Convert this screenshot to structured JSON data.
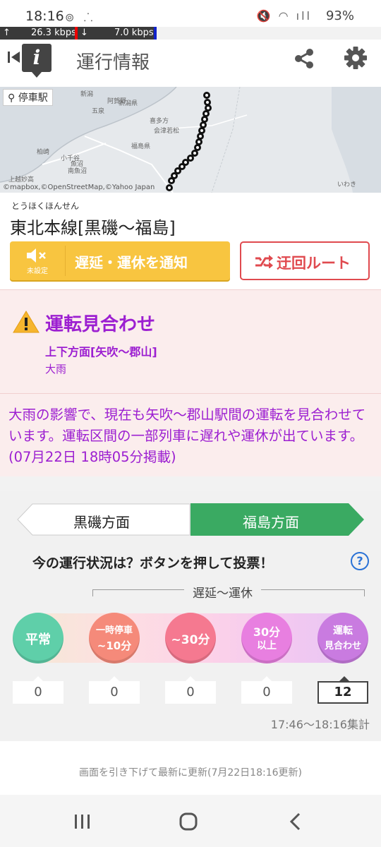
{
  "status_bar": {
    "time": "18:16",
    "battery": "93%",
    "up_speed": "26.3 kbps",
    "down_speed": "7.0 kbps"
  },
  "app_bar": {
    "title": "運行情報",
    "icons": [
      "back-icon",
      "info-logo-icon",
      "share-icon",
      "gear-icon"
    ]
  },
  "map": {
    "stop_label": "停車駅",
    "credit": "©mapbox,©OpenStreetMap,©Yahoo Japan",
    "places": [
      "新潟",
      "新潟県",
      "五泉",
      "阿賀野",
      "会津若松",
      "喜多方",
      "福島県",
      "柏崎",
      "魚沼",
      "小千谷",
      "南魚沼",
      "上越妙高",
      "いわき"
    ]
  },
  "line": {
    "kana": "とうほくほんせん",
    "name": "東北本線[黒磯～福島]"
  },
  "notify_button": {
    "label": "遅延・運休を通知",
    "sub_label": "未設定"
  },
  "detour_button": {
    "label": "迂回ルート"
  },
  "alert": {
    "status": "運転見合わせ",
    "section": "上下方面[矢吹～郡山]",
    "cause": "大雨",
    "message": "大雨の影響で、現在も矢吹～郡山駅間の運転を見合わせています。運転区間の一部列車に遅れや運休が出ています。(07月22日 18時05分掲載)"
  },
  "vote": {
    "tabs": [
      {
        "label": "黒磯方面",
        "active": false
      },
      {
        "label": "福島方面",
        "active": true
      }
    ],
    "question": "今の運行状況は？ボタンを押して投票！",
    "range_label": "遅延～運休",
    "options": [
      {
        "line1": "平常",
        "line2": "",
        "count": "0",
        "color": "#5fcfa9"
      },
      {
        "line1": "一時停車",
        "line2": "~10分",
        "count": "0",
        "color": "#f58a7a"
      },
      {
        "line1": "~30分",
        "line2": "",
        "count": "0",
        "color": "#f57990"
      },
      {
        "line1": "30分",
        "line2": "以上",
        "count": "0",
        "color": "#e87fe0"
      },
      {
        "line1": "運転",
        "line2": "見合わせ",
        "count": "12",
        "color": "#c97be0"
      }
    ],
    "period": "17:46～18:16集計"
  },
  "footer": {
    "update_text": "画面を引き下げて最新に更新(7月22日18:16更新)"
  },
  "colors": {
    "accent_green": "#3aaa62",
    "alert_purple": "#9c1fd1",
    "notify_yellow": "#f8c540",
    "detour_red": "#e04a4f"
  }
}
